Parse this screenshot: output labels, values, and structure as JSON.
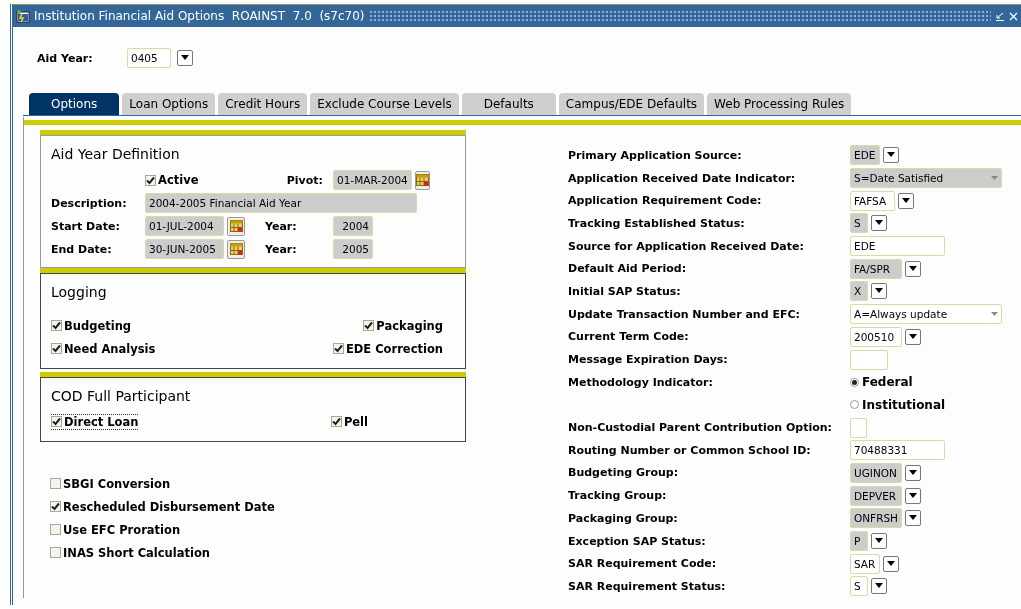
{
  "window": {
    "title": "Institution Financial Aid Options  ROAINST  7.0  (s7c70)"
  },
  "key_block": {
    "label": "Aid Year:",
    "value": "0405"
  },
  "tabs": [
    {
      "label": "Options",
      "selected": true
    },
    {
      "label": "Loan Options",
      "selected": false
    },
    {
      "label": "Credit Hours",
      "selected": false
    },
    {
      "label": "Exclude Course Levels",
      "selected": false
    },
    {
      "label": "Defaults",
      "selected": false
    },
    {
      "label": "Campus/EDE Defaults",
      "selected": false
    },
    {
      "label": "Web Processing Rules",
      "selected": false
    }
  ],
  "aid_year_definition": {
    "title": "Aid Year Definition",
    "active": {
      "label": "Active",
      "checked": true
    },
    "pivot": {
      "label": "Pivot:",
      "value": "01-MAR-2004"
    },
    "description": {
      "label": "Description:",
      "value": "2004-2005 Financial Aid Year"
    },
    "start_date": {
      "label": "Start Date:",
      "value": "01-JUL-2004"
    },
    "start_year": {
      "label": "Year:",
      "value": "2004"
    },
    "end_date": {
      "label": "End Date:",
      "value": "30-JUN-2005"
    },
    "end_year": {
      "label": "Year:",
      "value": "2005"
    }
  },
  "logging": {
    "title": "Logging",
    "options": [
      {
        "label": "Budgeting",
        "checked": true
      },
      {
        "label": "Packaging",
        "checked": true
      },
      {
        "label": "Need Analysis",
        "checked": true
      },
      {
        "label": "EDE Correction",
        "checked": true
      }
    ]
  },
  "cod_full_participant": {
    "title": "COD Full Participant",
    "options": [
      {
        "label": "Direct Loan",
        "checked": true,
        "focused": true
      },
      {
        "label": "Pell",
        "checked": true,
        "focused": false
      }
    ]
  },
  "options": [
    {
      "label": "SBGI Conversion",
      "checked": false
    },
    {
      "label": "Rescheduled Disbursement Date",
      "checked": true
    },
    {
      "label": "Use EFC Proration",
      "checked": false
    },
    {
      "label": "INAS Short Calculation",
      "checked": false
    }
  ],
  "settings": [
    {
      "kind": "lov",
      "label": "Primary Application Source:",
      "value": "EDE",
      "readonly": true
    },
    {
      "kind": "select",
      "label": "Application Received Date Indicator:",
      "value": "S=Date Satisfied",
      "readonly": true
    },
    {
      "kind": "lov",
      "label": "Application Requirement Code:",
      "value": "FAFSA",
      "readonly": false
    },
    {
      "kind": "lov",
      "label": "Tracking Established Status:",
      "value": "S",
      "readonly": true
    },
    {
      "kind": "text",
      "label": "Source for Application Received Date:",
      "value": "EDE",
      "readonly": false
    },
    {
      "kind": "lov",
      "label": "Default Aid Period:",
      "value": "FA/SPR",
      "readonly": true
    },
    {
      "kind": "lov",
      "label": "Initial SAP Status:",
      "value": "X",
      "readonly": true
    },
    {
      "kind": "select",
      "label": "Update Transaction Number and EFC:",
      "value": "A=Always update",
      "readonly": false
    },
    {
      "kind": "lov",
      "label": "Current Term Code:",
      "value": "200510",
      "readonly": false
    },
    {
      "kind": "text",
      "label": "Message Expiration Days:",
      "readonly": false
    },
    {
      "kind": "radio",
      "label": "Methodology Indicator:",
      "options": [
        {
          "label": "Federal",
          "selected": true
        },
        {
          "label": "Institutional",
          "selected": false
        }
      ]
    },
    {
      "kind": "text",
      "label": "Non-Custodial Parent Contribution Option:",
      "readonly": false
    },
    {
      "kind": "text",
      "label": "Routing Number or Common School ID:",
      "value": "70488331",
      "readonly": false
    },
    {
      "kind": "lov",
      "label": "Budgeting Group:",
      "value": "UGINON",
      "readonly": true
    },
    {
      "kind": "lov",
      "label": "Tracking Group:",
      "value": "DEPVER",
      "readonly": true
    },
    {
      "kind": "lov",
      "label": "Packaging Group:",
      "value": "ONFRSH",
      "readonly": true
    },
    {
      "kind": "lov",
      "label": "Exception SAP Status:",
      "value": "P",
      "readonly": true
    },
    {
      "kind": "lov",
      "label": "SAR Requirement Code:",
      "value": "SAR",
      "readonly": false
    },
    {
      "kind": "lov",
      "label": "SAR Requirement Status:",
      "value": "S",
      "readonly": false
    }
  ]
}
